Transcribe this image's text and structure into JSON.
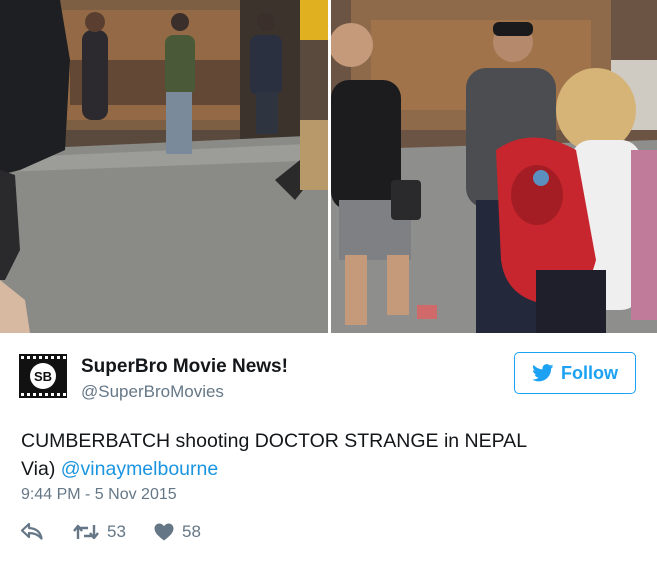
{
  "tweet": {
    "display_name": "SuperBro Movie News!",
    "handle": "@SuperBroMovies",
    "avatar_text": "SB",
    "follow_label": "Follow",
    "text_main": "CUMBERBATCH shooting DOCTOR STRANGE in NEPAL",
    "text_via": "Via)",
    "mention": "@vinaymelbourne",
    "timestamp": "9:44 PM - 5 Nov 2015",
    "retweet_count": "53",
    "like_count": "58"
  },
  "colors": {
    "accent": "#1da1f2",
    "mention": "#1b95e0",
    "secondary_text": "#657786",
    "primary_text": "#14171a"
  },
  "icons": [
    "bird-icon",
    "reply-icon",
    "retweet-icon",
    "heart-icon"
  ],
  "media": {
    "count": 2,
    "descriptions_hidden": true
  }
}
